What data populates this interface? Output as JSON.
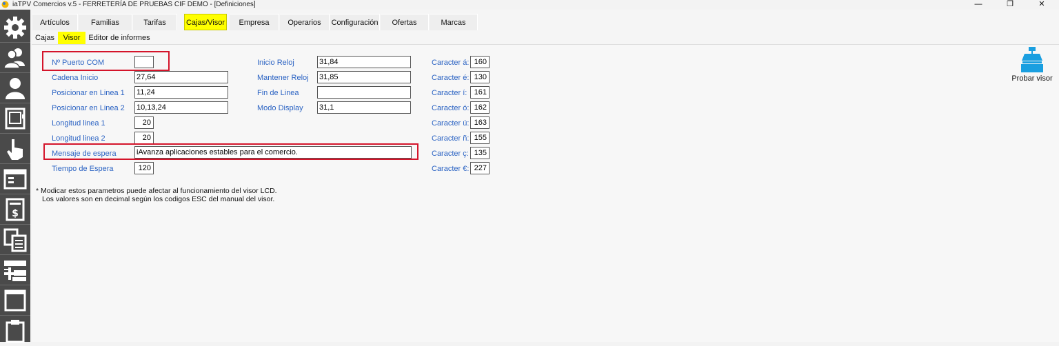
{
  "window": {
    "title": "iaTPV Comercios v.5 - FERRETERÍA DE PRUEBAS CIF DEMO - [Definiciones]",
    "controls": [
      "—",
      "❐",
      "✕"
    ]
  },
  "sidebar": {
    "items": [
      {
        "icon": "gear-icon"
      },
      {
        "icon": "users-icon"
      },
      {
        "icon": "user-icon"
      },
      {
        "icon": "safe-icon"
      },
      {
        "icon": "hand-pointer-icon"
      },
      {
        "icon": "window-icon"
      },
      {
        "icon": "price-list-icon"
      },
      {
        "icon": "copy-documents-icon"
      },
      {
        "icon": "add-items-icon"
      },
      {
        "icon": "screen-icon"
      },
      {
        "icon": "clipboard-icon"
      }
    ]
  },
  "main_tabs": [
    {
      "label": "Artículos",
      "active": false
    },
    {
      "label": "Familias",
      "active": false
    },
    {
      "label": "Tarifas",
      "active": false
    },
    {
      "label": "Cajas/Visor",
      "active": true
    },
    {
      "label": "Empresa",
      "active": false
    },
    {
      "label": "Operarios",
      "active": false
    },
    {
      "label": "Configuración",
      "active": false
    },
    {
      "label": "Ofertas",
      "active": false
    },
    {
      "label": "Marcas",
      "active": false
    }
  ],
  "sub_tabs": [
    {
      "label": "Cajas",
      "active": false
    },
    {
      "label": "Visor",
      "active": true
    },
    {
      "label": "Editor de informes",
      "active": false
    }
  ],
  "form": {
    "puerto_com": {
      "label": "Nº Puerto COM",
      "value": ""
    },
    "cadena_inicio": {
      "label": "Cadena Inicio",
      "value": "27,64"
    },
    "posicionar_linea1": {
      "label": "Posicionar en Linea 1",
      "value": "11,24"
    },
    "posicionar_linea2": {
      "label": "Posicionar en Linea 2",
      "value": "10,13,24"
    },
    "longitud_linea1": {
      "label": "Longitud linea 1",
      "value": "20"
    },
    "longitud_linea2": {
      "label": "Longitud linea 2",
      "value": "20"
    },
    "mensaje_espera": {
      "label": "Mensaje de espera",
      "value": "iAvanza aplicaciones estables para el comercio."
    },
    "tiempo_espera": {
      "label": "Tiempo de Espera",
      "value": "120"
    },
    "inicio_reloj": {
      "label": "Inicio Reloj",
      "value": "31,84"
    },
    "mantener_reloj": {
      "label": "Mantener Reloj",
      "value": "31,85"
    },
    "fin_linea": {
      "label": "Fin de Linea",
      "value": ""
    },
    "modo_display": {
      "label": "Modo Display",
      "value": "31,1"
    },
    "caracteres": [
      {
        "label": "Caracter á:",
        "value": "160"
      },
      {
        "label": "Caracter é:",
        "value": "130"
      },
      {
        "label": "Caracter í:",
        "value": "161"
      },
      {
        "label": "Caracter ó:",
        "value": "162"
      },
      {
        "label": "Caracter ú:",
        "value": "163"
      },
      {
        "label": "Caracter ñ:",
        "value": "155"
      },
      {
        "label": "Caracter ç:",
        "value": "135"
      },
      {
        "label": "Caracter €:",
        "value": "227"
      }
    ]
  },
  "notes": {
    "line1": "* Modicar estos parametros puede afectar al funcionamiento del visor LCD.",
    "line2": "Los valores son en decimal según los codigos ESC del manual del visor."
  },
  "actions": {
    "probar_visor": "Probar visor"
  },
  "colors": {
    "active_tab": "#ffff00",
    "label_blue": "#2b63c3",
    "highlight_red": "#d4142a",
    "sidebar": "#4a4a4a",
    "probar_icon": "#1a9fe0"
  }
}
